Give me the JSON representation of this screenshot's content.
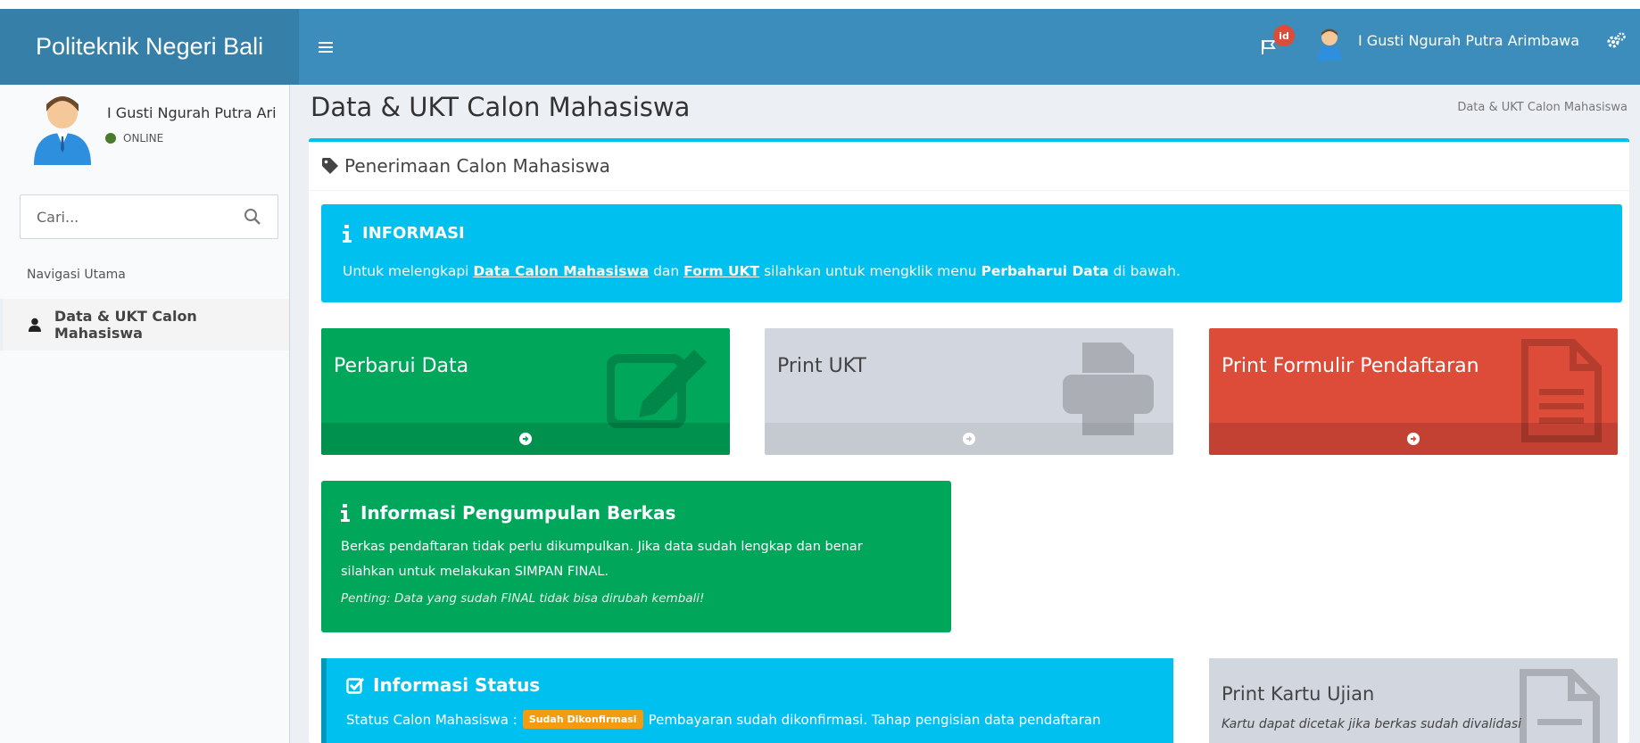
{
  "app": {
    "brand": "Politeknik Negeri Bali"
  },
  "topbar": {
    "notification_badge": "id",
    "user_name": "I Gusti Ngurah Putra Arimbawa"
  },
  "sidebar": {
    "user_name": "I Gusti Ngurah Putra Ari",
    "status": "ONLINE",
    "search_placeholder": "Cari...",
    "nav_header": "Navigasi Utama",
    "items": [
      {
        "label": "Data & UKT Calon Mahasiswa"
      }
    ]
  },
  "page": {
    "title": "Data & UKT Calon Mahasiswa",
    "breadcrumb": "Data & UKT Calon Mahasiswa",
    "box_title": "Penerimaan Calon Mahasiswa"
  },
  "info_callout": {
    "title": "INFORMASI",
    "text_1": "Untuk melengkapi ",
    "link_1": "Data Calon Mahasiswa",
    "text_2": " dan ",
    "link_2": "Form UKT",
    "text_3": " silahkan untuk mengklik menu ",
    "bold_1": "Perbaharui Data",
    "text_4": " di bawah."
  },
  "tiles": [
    {
      "label": "Perbarui Data"
    },
    {
      "label": "Print UKT"
    },
    {
      "label": "Print Formulir Pendaftaran"
    }
  ],
  "berkas_callout": {
    "title": "Informasi Pengumpulan Berkas",
    "line_1": "Berkas pendaftaran tidak perlu dikumpulkan. Jika data sudah lengkap dan benar",
    "line_2": "silahkan untuk melakukan SIMPAN FINAL.",
    "note": "Penting: Data yang sudah FINAL tidak bisa dirubah kembali!"
  },
  "status_callout": {
    "title": "Informasi Status",
    "label": "Status Calon Mahasiswa :",
    "badge": "Sudah Dikonfirmasi",
    "text": "Pembayaran sudah dikonfirmasi. Tahap pengisian data pendaftaran"
  },
  "kartu_tile": {
    "title": "Print Kartu Ujian",
    "note": "Kartu dapat dicetak jika berkas sudah divalidasi"
  },
  "colors": {
    "navbar": "#3c8dbc",
    "brand_bg": "#367fa9",
    "info": "#00c0ef",
    "success": "#00a65a",
    "danger": "#dd4b39",
    "gray": "#d2d6de",
    "warning": "#f39c12"
  }
}
